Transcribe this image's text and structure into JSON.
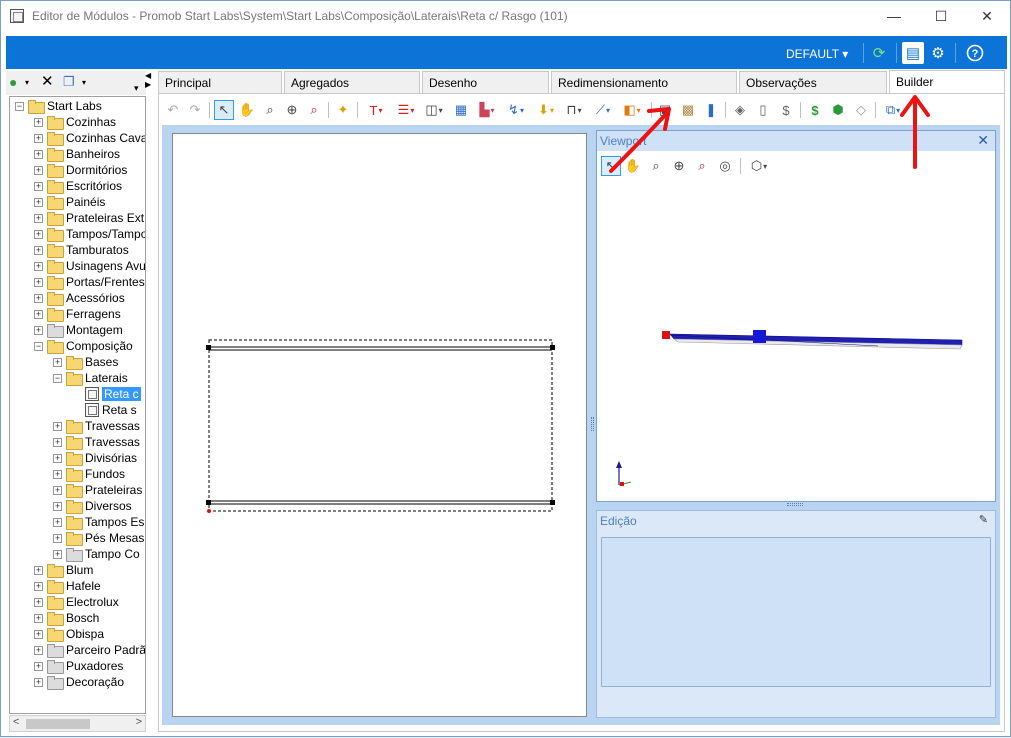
{
  "window": {
    "title": "Editor de Módulos - Promob Start Labs\\System\\Start Labs\\Composição\\Laterais\\Reta c/ Rasgo (101)",
    "minimize": "—",
    "maximize": "☐",
    "close": "✕"
  },
  "ribbon": {
    "profile": "DEFAULT ▾",
    "refresh_icon": "refresh-icon",
    "layout_icon": "panel-layout-icon",
    "settings_icon": "settings-icon",
    "help_icon": "help-icon"
  },
  "tree": {
    "items": [
      {
        "label": "Start Labs",
        "level": 0,
        "kind": "folder-open",
        "exp": "−"
      },
      {
        "label": "Cozinhas",
        "level": 1,
        "kind": "folder",
        "exp": "+"
      },
      {
        "label": "Cozinhas Cava",
        "level": 1,
        "kind": "folder",
        "exp": "+"
      },
      {
        "label": "Banheiros",
        "level": 1,
        "kind": "folder",
        "exp": "+"
      },
      {
        "label": "Dormitórios",
        "level": 1,
        "kind": "folder",
        "exp": "+"
      },
      {
        "label": "Escritórios",
        "level": 1,
        "kind": "folder",
        "exp": "+"
      },
      {
        "label": "Painéis",
        "level": 1,
        "kind": "folder",
        "exp": "+"
      },
      {
        "label": "Prateleiras Ext",
        "level": 1,
        "kind": "folder",
        "exp": "+"
      },
      {
        "label": "Tampos/Tampo",
        "level": 1,
        "kind": "folder",
        "exp": "+"
      },
      {
        "label": "Tamburatos",
        "level": 1,
        "kind": "folder",
        "exp": "+"
      },
      {
        "label": "Usinagens Avu",
        "level": 1,
        "kind": "folder",
        "exp": "+"
      },
      {
        "label": "Portas/Frentes",
        "level": 1,
        "kind": "folder",
        "exp": "+"
      },
      {
        "label": "Acessórios",
        "level": 1,
        "kind": "folder",
        "exp": "+"
      },
      {
        "label": "Ferragens",
        "level": 1,
        "kind": "folder",
        "exp": "+"
      },
      {
        "label": "Montagem",
        "level": 1,
        "kind": "folder-grey",
        "exp": "+"
      },
      {
        "label": "Composição",
        "level": 1,
        "kind": "folder-open",
        "exp": "−"
      },
      {
        "label": "Bases",
        "level": 2,
        "kind": "folder",
        "exp": "+"
      },
      {
        "label": "Laterais",
        "level": 2,
        "kind": "folder-open",
        "exp": "−"
      },
      {
        "label": "Reta c",
        "level": 3,
        "kind": "doc",
        "exp": "",
        "selected": true
      },
      {
        "label": "Reta s",
        "level": 3,
        "kind": "doc",
        "exp": ""
      },
      {
        "label": "Travessas",
        "level": 2,
        "kind": "folder",
        "exp": "+"
      },
      {
        "label": "Travessas",
        "level": 2,
        "kind": "folder",
        "exp": "+"
      },
      {
        "label": "Divisórias",
        "level": 2,
        "kind": "folder",
        "exp": "+"
      },
      {
        "label": "Fundos",
        "level": 2,
        "kind": "folder",
        "exp": "+"
      },
      {
        "label": "Prateleiras",
        "level": 2,
        "kind": "folder",
        "exp": "+"
      },
      {
        "label": "Diversos",
        "level": 2,
        "kind": "folder",
        "exp": "+"
      },
      {
        "label": "Tampos Es",
        "level": 2,
        "kind": "folder",
        "exp": "+"
      },
      {
        "label": "Pés Mesas",
        "level": 2,
        "kind": "folder",
        "exp": "+"
      },
      {
        "label": "Tampo Co",
        "level": 2,
        "kind": "folder-grey",
        "exp": "+"
      },
      {
        "label": "Blum",
        "level": 1,
        "kind": "folder",
        "exp": "+"
      },
      {
        "label": "Hafele",
        "level": 1,
        "kind": "folder",
        "exp": "+"
      },
      {
        "label": "Electrolux",
        "level": 1,
        "kind": "folder",
        "exp": "+"
      },
      {
        "label": "Bosch",
        "level": 1,
        "kind": "folder",
        "exp": "+"
      },
      {
        "label": "Obispa",
        "level": 1,
        "kind": "folder",
        "exp": "+"
      },
      {
        "label": "Parceiro Padrã",
        "level": 1,
        "kind": "folder-grey",
        "exp": "+"
      },
      {
        "label": "Puxadores",
        "level": 1,
        "kind": "folder-grey",
        "exp": "+"
      },
      {
        "label": "Decoração",
        "level": 1,
        "kind": "folder-grey",
        "exp": "+"
      }
    ]
  },
  "tabs": [
    {
      "label": "Principal"
    },
    {
      "label": "Agregados"
    },
    {
      "label": "Desenho"
    },
    {
      "label": "Redimensionamento"
    },
    {
      "label": "Observações"
    },
    {
      "label": "Builder",
      "active": true
    }
  ],
  "viewport": {
    "title": "Viewport",
    "close": "✕"
  },
  "edicao": {
    "title": "Edição",
    "pin": "📌"
  },
  "colors": {
    "ribbon": "#0c74d6",
    "workarea": "#b9d4f0",
    "annotation_arrow": "#ee1111",
    "model_blue": "#1616c8",
    "handle_red": "#dd1111"
  }
}
